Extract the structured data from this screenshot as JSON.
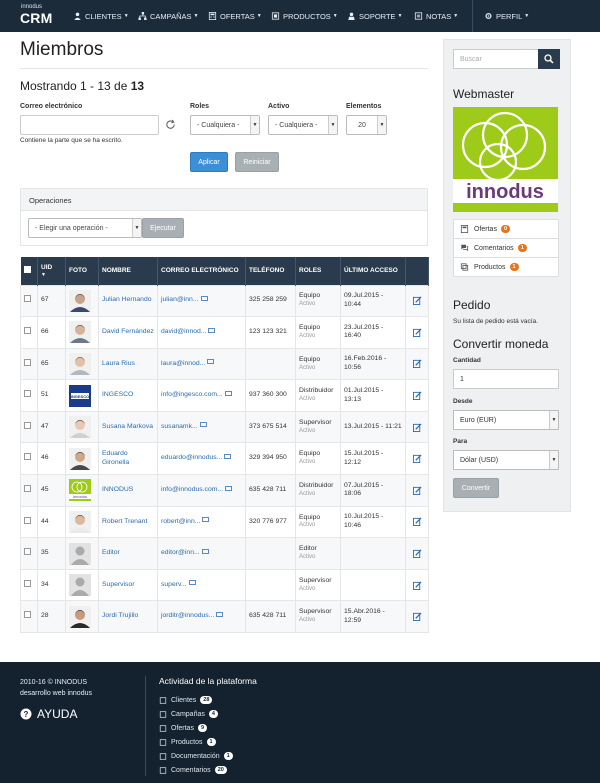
{
  "brand": {
    "small": "innodus",
    "big": "CRM"
  },
  "nav": [
    {
      "label": "CLIENTES",
      "icon": "user-icon"
    },
    {
      "label": "CAMPAÑAS",
      "icon": "sitemap-icon"
    },
    {
      "label": "OFERTAS",
      "icon": "calculator-icon"
    },
    {
      "label": "PRODUCTOS",
      "icon": "box-icon"
    },
    {
      "label": "SOPORTE",
      "icon": "support-icon"
    },
    {
      "label": "NOTAS",
      "icon": "notes-icon"
    },
    {
      "label": "PERFIL",
      "icon": "gear-icon"
    }
  ],
  "page": {
    "title": "Miembros",
    "showing_prefix": "Mostrando 1 - 13 de",
    "showing_total": "13"
  },
  "filters": {
    "email_label": "Correo electrónico",
    "email_value": "",
    "email_hint": "Contiene la parte que se ha escrito.",
    "roles_label": "Roles",
    "roles_value": "- Cualquiera -",
    "active_label": "Activo",
    "active_value": "- Cualquiera -",
    "items_label": "Elementos",
    "items_value": "20",
    "apply": "Aplicar",
    "reset": "Reiniciar"
  },
  "operations": {
    "title": "Operaciones",
    "select": "- Elegir una operación -",
    "execute": "Ejecutar"
  },
  "table": {
    "headers": [
      "UID",
      "FOTO",
      "NOMBRE",
      "CORREO ELECTRÓNICO",
      "TELÉFONO",
      "ROLES",
      "ÚLTIMO ACCESO"
    ],
    "rows": [
      {
        "uid": "67",
        "name": "Julian Hernando",
        "email": "julian@inn...",
        "phone": "325 258 259",
        "role": "Equipo",
        "status": "Activo",
        "access": "09.Jul.2015 - 10:44",
        "avatar": "man-suit"
      },
      {
        "uid": "66",
        "name": "David Fernández",
        "email": "david@innod...",
        "phone": "123 123 321",
        "role": "Equipo",
        "status": "Activo",
        "access": "23.Jul.2015 - 16:40",
        "avatar": "man-glasses"
      },
      {
        "uid": "65",
        "name": "Laura Rius",
        "email": "laura@innod...",
        "phone": "",
        "role": "Equipo",
        "status": "Activo",
        "access": "16.Feb.2016 - 10:56",
        "avatar": "woman"
      },
      {
        "uid": "51",
        "name": "INGESCO",
        "email": "info@ingesco.com...",
        "phone": "937 360 300",
        "role": "Distribuidor",
        "status": "Activo",
        "access": "01.Jul.2015 - 13:13",
        "avatar": "ingesco-logo"
      },
      {
        "uid": "47",
        "name": "Susana Markova",
        "email": "susanamk...",
        "phone": "373 675 514",
        "role": "Supervisor",
        "status": "Activo",
        "access": "13.Jul.2015 - 11:21",
        "avatar": "woman-dark"
      },
      {
        "uid": "46",
        "name": "Eduardo Gironella",
        "email": "eduardo@innodus...",
        "phone": "329 394 950",
        "role": "Equipo",
        "status": "Activo",
        "access": "15.Jul.2015 - 12:12",
        "avatar": "man-beard"
      },
      {
        "uid": "45",
        "name": "INNODUS",
        "email": "info@innodus.com...",
        "phone": "635 428 711",
        "role": "Distribuidor",
        "status": "Activo",
        "access": "07.Jul.2015 - 18:06",
        "avatar": "innodus-logo"
      },
      {
        "uid": "44",
        "name": "Robert Trenant",
        "email": "robert@inn...",
        "phone": "320 776 977",
        "role": "Equipo",
        "status": "Activo",
        "access": "10.Jul.2015 - 10:46",
        "avatar": "man-shirt"
      },
      {
        "uid": "35",
        "name": "Editor",
        "email": "editor@inn...",
        "phone": "",
        "role": "Editor",
        "status": "Activo",
        "access": "",
        "avatar": "placeholder"
      },
      {
        "uid": "34",
        "name": "Supervisor",
        "email": "superv...",
        "phone": "",
        "role": "Supervisor",
        "status": "Activo",
        "access": "",
        "avatar": "placeholder"
      },
      {
        "uid": "28",
        "name": "Jordi Trujillo",
        "email": "jorditr@innodus...",
        "phone": "635 428 711",
        "role": "Supervisor",
        "status": "Activo",
        "access": "15.Abr.2016 - 12:59",
        "avatar": "man-dark"
      }
    ]
  },
  "sidebar": {
    "search_placeholder": "Buscar",
    "webmaster_title": "Webmaster",
    "logo_text": "innodus",
    "links": [
      {
        "label": "Ofertas",
        "count": "0",
        "icon": "calculator-icon"
      },
      {
        "label": "Comentarios",
        "count": "1",
        "icon": "comments-icon"
      },
      {
        "label": "Productos",
        "count": "1",
        "icon": "box-icon"
      }
    ],
    "order_title": "Pedido",
    "order_text": "Su lista de pedido está vacía.",
    "currency_title": "Convertir moneda",
    "qty_label": "Cantidad",
    "qty_value": "1",
    "from_label": "Desde",
    "from_value": "Euro (EUR)",
    "to_label": "Para",
    "to_value": "Dólar (USD)",
    "convert": "Convertir"
  },
  "footer": {
    "copy1": "2010-16 © INNODUS",
    "copy2": "desarrollo web innodus",
    "help": "AYUDA",
    "activity_title": "Actividad de la plataforma",
    "activity": [
      {
        "label": "Clientes",
        "count": "28",
        "icon": "user-icon"
      },
      {
        "label": "Campañas",
        "count": "4",
        "icon": "sitemap-icon"
      },
      {
        "label": "Ofertas",
        "count": "9",
        "icon": "calculator-icon"
      },
      {
        "label": "Productos",
        "count": "1",
        "icon": "box-icon"
      },
      {
        "label": "Documentación",
        "count": "1",
        "icon": "folder-icon"
      },
      {
        "label": "Comentarios",
        "count": "20",
        "icon": "comments-icon"
      }
    ]
  },
  "colors": {
    "navbar": "#1b2b3a",
    "accent": "#3b8fd6",
    "badge": "#e8741c",
    "logo_green": "#9ecb1a"
  }
}
